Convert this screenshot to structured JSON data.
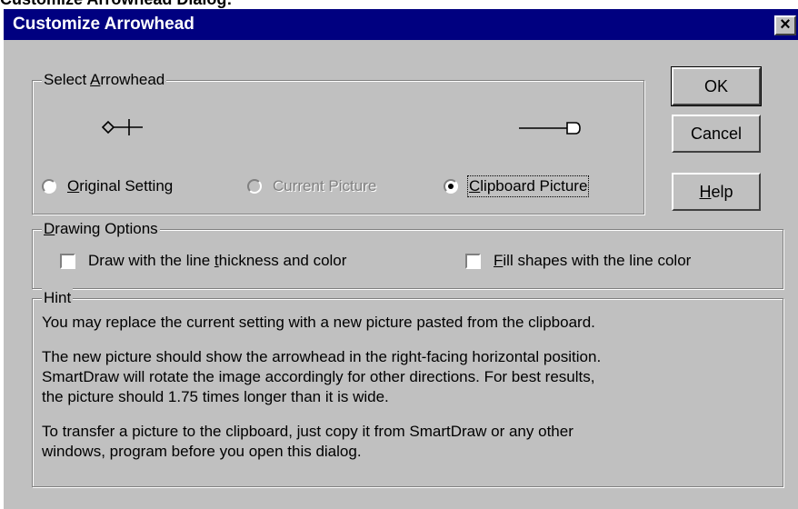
{
  "page_caption": "Customize Arrowhead Dialog:",
  "window": {
    "title": "Customize Arrowhead",
    "close_glyph": "×"
  },
  "select_group": {
    "label_pre": "Select ",
    "label_key": "A",
    "label_post": "rrowhead",
    "options": [
      {
        "key": "O",
        "rest": "riginal Setting",
        "checked": false,
        "enabled": true
      },
      {
        "text": "Current Picture",
        "checked": false,
        "enabled": false
      },
      {
        "key": "C",
        "rest": "lipboard Picture",
        "checked": true,
        "enabled": true,
        "focused": true
      }
    ],
    "previews": [
      "original-arrowhead-icon",
      "clipboard-arrowhead-icon"
    ]
  },
  "buttons": {
    "ok": "OK",
    "cancel": "Cancel",
    "help_key": "H",
    "help_rest": "elp"
  },
  "drawing_group": {
    "label_key": "D",
    "label_rest": "rawing Options",
    "thickness_pre": "Draw with the line ",
    "thickness_key": "t",
    "thickness_post": "hickness and color",
    "fill_key": "F",
    "fill_rest": "ill shapes with the line color",
    "thickness_checked": false,
    "fill_checked": false
  },
  "hint_group": {
    "label": "Hint",
    "lines": [
      "You may replace the current setting with a new picture pasted from the clipboard.",
      "The new picture should show the arrowhead in the right-facing horizontal position.",
      "SmartDraw will rotate the image accordingly for other directions. For best results,",
      "the picture should 1.75 times longer than it is wide.",
      "To transfer a picture to the clipboard, just copy it from SmartDraw or any other",
      "windows, program before you open this dialog."
    ]
  },
  "colors": {
    "title_bar": "#000080",
    "face": "#c0c0c0",
    "disabled_text": "#808080"
  }
}
